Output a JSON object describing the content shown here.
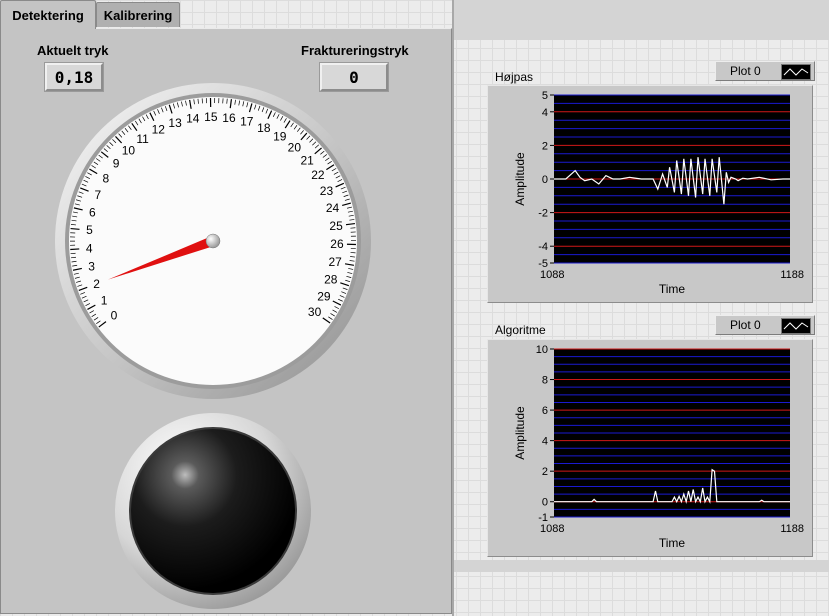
{
  "tabs": [
    {
      "label": "Detektering",
      "active": true
    },
    {
      "label": "Kalibrering",
      "active": false
    }
  ],
  "detektering": {
    "actual_label": "Aktuelt tryk",
    "actual_value": "0,18",
    "fracture_label": "Frakturerings­tryk",
    "fracture_value": "0"
  },
  "gauge": {
    "min": 0,
    "max": 30,
    "value": 2,
    "ticks": [
      "0",
      "1",
      "2",
      "3",
      "4",
      "5",
      "6",
      "7",
      "8",
      "9",
      "10",
      "11",
      "12",
      "13",
      "14",
      "15",
      "16",
      "17",
      "18",
      "19",
      "20",
      "21",
      "22",
      "23",
      "24",
      "25",
      "26",
      "27",
      "28",
      "29",
      "30"
    ],
    "needle_color": "#e01010"
  },
  "led": {
    "state": "off",
    "color": "#000000"
  },
  "graphs": [
    {
      "title": "Højpas",
      "legend": "Plot 0",
      "ylabel": "Amplitude",
      "xlabel": "Time",
      "x_ticks": [
        "1088",
        "1188"
      ],
      "y_ticks": [
        "5",
        "4",
        "2",
        "0",
        "-2",
        "-4",
        "-5"
      ],
      "ylim": [
        -5,
        5
      ],
      "xlim": [
        1088,
        1188
      ]
    },
    {
      "title": "Algoritme",
      "legend": "Plot 0",
      "ylabel": "Amplitude",
      "xlabel": "Time",
      "x_ticks": [
        "1088",
        "1188"
      ],
      "y_ticks": [
        "10",
        "8",
        "6",
        "4",
        "2",
        "0",
        "-1"
      ],
      "ylim": [
        -1,
        10
      ],
      "xlim": [
        1088,
        1188
      ]
    }
  ],
  "chart_data": [
    {
      "type": "line",
      "title": "Højpas",
      "xlabel": "Time",
      "ylabel": "Amplitude",
      "xlim": [
        1088,
        1188
      ],
      "ylim": [
        -5,
        5
      ],
      "grid": true,
      "series": [
        {
          "name": "Plot 0",
          "color": "#ffffff",
          "x": [
            1088,
            1093,
            1097,
            1099,
            1101,
            1104,
            1107,
            1110,
            1113,
            1116,
            1120,
            1125,
            1130,
            1132,
            1134,
            1136,
            1137,
            1139,
            1140,
            1142,
            1143,
            1145,
            1146,
            1148,
            1149,
            1151,
            1152,
            1154,
            1155,
            1157,
            1158,
            1160,
            1161,
            1162,
            1163,
            1165,
            1166,
            1168,
            1170,
            1175,
            1180,
            1185,
            1188
          ],
          "y": [
            0,
            0,
            0.5,
            0.1,
            -0.1,
            0,
            -0.3,
            0.2,
            0,
            0,
            0.1,
            0,
            0,
            -0.6,
            0.3,
            -0.5,
            0.7,
            -0.8,
            1.1,
            -0.9,
            1.2,
            -1,
            1.2,
            -1.1,
            1.3,
            -0.9,
            1.2,
            -1,
            1.2,
            -0.8,
            1.3,
            -1.5,
            0.4,
            -0.2,
            0.1,
            0,
            -0.1,
            0.05,
            0,
            0.1,
            -0.05,
            0,
            0
          ]
        }
      ]
    },
    {
      "type": "line",
      "title": "Algoritme",
      "xlabel": "Time",
      "ylabel": "Amplitude",
      "xlim": [
        1088,
        1188
      ],
      "ylim": [
        -1,
        10
      ],
      "grid": true,
      "series": [
        {
          "name": "Plot 0",
          "color": "#ffffff",
          "x": [
            1088,
            1104,
            1105,
            1106,
            1130,
            1131,
            1132,
            1138,
            1139,
            1140,
            1141,
            1142,
            1143,
            1144,
            1145,
            1146,
            1147,
            1148,
            1149,
            1150,
            1151,
            1152,
            1153,
            1154,
            1155,
            1156,
            1157,
            1160,
            1175,
            1176,
            1177,
            1188
          ],
          "y": [
            0,
            0,
            0.15,
            0,
            0,
            0.7,
            0,
            0,
            0.3,
            0,
            0.35,
            0,
            0.5,
            0,
            0.7,
            0,
            0.8,
            0,
            0.3,
            0,
            0.9,
            0,
            0.3,
            0,
            2.1,
            2.0,
            0,
            0,
            0,
            0.1,
            0,
            0
          ]
        }
      ]
    }
  ]
}
